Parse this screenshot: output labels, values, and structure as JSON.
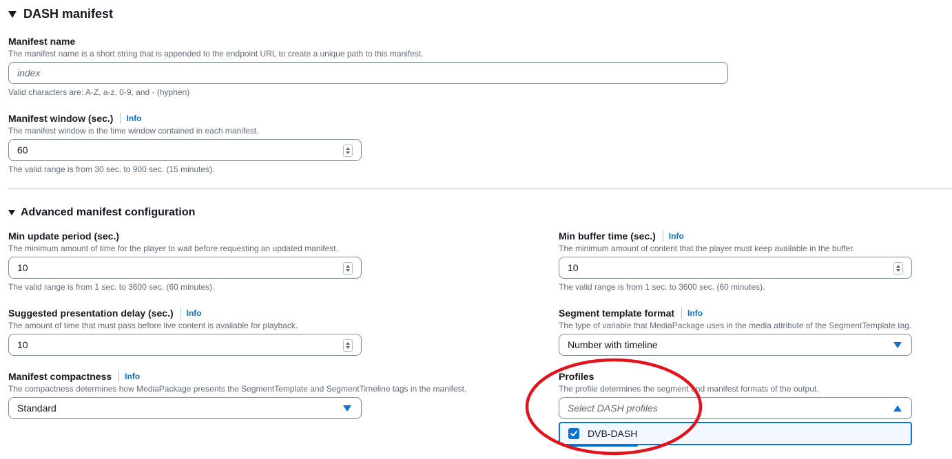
{
  "dash_section": {
    "title": "DASH manifest"
  },
  "manifest_name": {
    "label": "Manifest name",
    "description": "The manifest name is a short string that is appended to the endpoint URL to create a unique path to this manifest.",
    "placeholder": "index",
    "hint": "Valid characters are: A-Z, a-z, 0-9, and - (hyphen)"
  },
  "manifest_window": {
    "label": "Manifest window (sec.)",
    "info": "Info",
    "description": "The manifest window is the time window contained in each manifest.",
    "value": "60",
    "hint": "The valid range is from 30 sec. to 900 sec. (15 minutes)."
  },
  "advanced_section": {
    "title": "Advanced manifest configuration"
  },
  "min_update_period": {
    "label": "Min update period (sec.)",
    "description": "The minimum amount of time for the player to wait before requesting an updated manifest.",
    "value": "10",
    "hint": "The valid range is from 1 sec. to 3600 sec. (60 minutes)."
  },
  "min_buffer_time": {
    "label": "Min buffer time (sec.)",
    "info": "Info",
    "description": "The minimum amount of content that the player must keep available in the buffer.",
    "value": "10",
    "hint": "The valid range is from 1 sec. to 3600 sec. (60 minutes)."
  },
  "suggested_presentation_delay": {
    "label": "Suggested presentation delay (sec.)",
    "info": "Info",
    "description": "The amount of time that must pass before live content is available for playback.",
    "value": "10"
  },
  "segment_template_format": {
    "label": "Segment template format",
    "info": "Info",
    "description": "The type of variable that MediaPackage uses in the media attribute of the SegmentTemplate tag.",
    "value": "Number with timeline"
  },
  "manifest_compactness": {
    "label": "Manifest compactness",
    "info": "Info",
    "description": "The compactness determines how MediaPackage presents the SegmentTemplate and SegmentTimeline tags in the manifest.",
    "value": "Standard"
  },
  "profiles": {
    "label": "Profiles",
    "description": "The profile determines the segment and manifest formats of the output.",
    "placeholder": "Select DASH profiles",
    "options": [
      {
        "label": "DVB-DASH",
        "checked": true
      }
    ]
  },
  "colors": {
    "accent": "#0972d3",
    "annotation": "#e3121b",
    "text": "#16191f",
    "muted": "#5f6b7a"
  }
}
